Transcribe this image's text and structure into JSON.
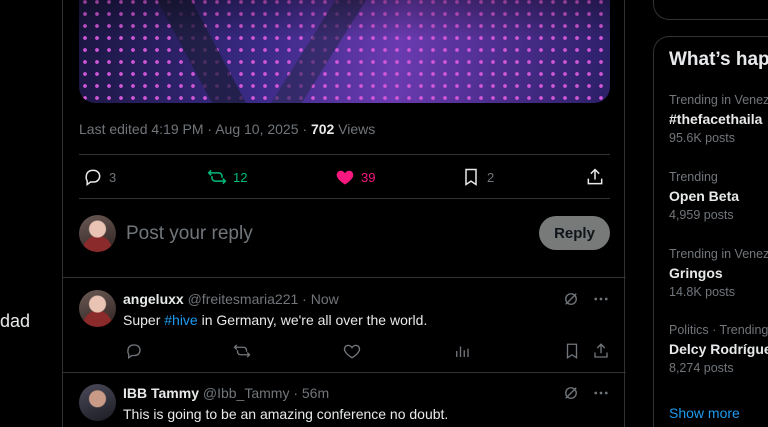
{
  "left_fragment": "dad",
  "tweet": {
    "meta_prefix": "Last edited 4:19 PM · Aug 10, 2025 · ",
    "views_count": "702",
    "views_label": " Views",
    "stats": {
      "replies": "3",
      "retweets": "12",
      "likes": "39",
      "bookmarks": "2"
    }
  },
  "reply_box": {
    "placeholder": "Post your reply",
    "button_label": "Reply"
  },
  "replies": [
    {
      "name": "angeluxx",
      "handle": "@freitesmaria221 · Now",
      "text_before": "Super ",
      "hashtag": "#hive",
      "text_after": " in Germany, we're all over the world."
    },
    {
      "name": "IBB Tammy",
      "handle": "@Ibb_Tammy · 56m",
      "text": "This is going to be an amazing conference no doubt."
    }
  ],
  "trends_panel": {
    "title": "What’s hap",
    "items": [
      {
        "context": "Trending in Venez",
        "title": "#thefacethaila",
        "count": "95.6K posts"
      },
      {
        "context": "Trending",
        "title": "Open Beta",
        "count": "4,959 posts"
      },
      {
        "context": "Trending in Venez",
        "title": "Gringos",
        "count": "14.8K posts"
      },
      {
        "context": "Politics · Trending",
        "title": "Delcy Rodrígue",
        "count": "8,274 posts"
      }
    ],
    "show_more": "Show more"
  },
  "colors": {
    "accent": "#1d9bf0",
    "retweet_green": "#00ba7c",
    "like_pink": "#f91880",
    "muted": "#71767b"
  }
}
